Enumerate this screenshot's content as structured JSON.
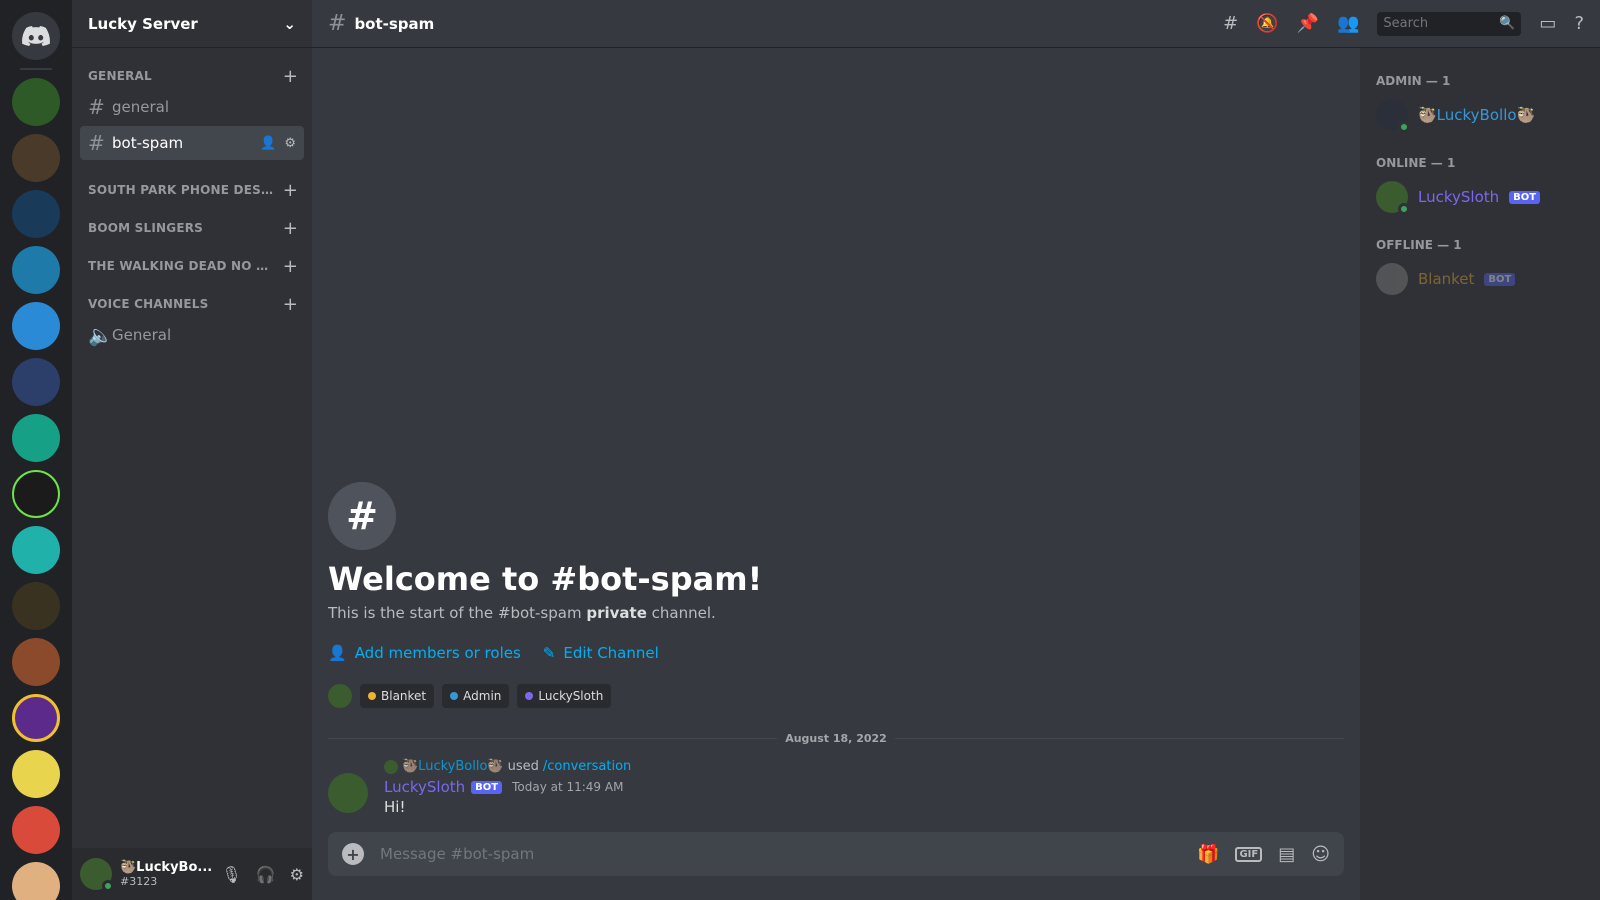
{
  "server": {
    "name": "Lucky Server"
  },
  "channel": {
    "name": "bot-spam",
    "search_placeholder": "Search"
  },
  "categories": [
    {
      "label": "GENERAL"
    },
    {
      "label": "SOUTH PARK PHONE DESTRO..."
    },
    {
      "label": "BOOM SLINGERS"
    },
    {
      "label": "THE WALKING DEAD NO MAN..."
    },
    {
      "label": "VOICE CHANNELS"
    }
  ],
  "channels": {
    "general": "general",
    "bot_spam": "bot-spam",
    "voice_general": "General"
  },
  "user": {
    "name": "🦥LuckyBo...",
    "tag": "#3123"
  },
  "welcome": {
    "title": "Welcome to #bot-spam!",
    "sub_pre": "This is the start of the #bot-spam",
    "sub_bold": "private",
    "sub_post": "channel.",
    "add_members": "Add members or roles",
    "edit_channel": "Edit Channel"
  },
  "roles": [
    {
      "name": "Blanket",
      "color": "#f0b232"
    },
    {
      "name": "Admin",
      "color": "#3498db"
    },
    {
      "name": "LuckySloth",
      "color": "#7b68ee"
    }
  ],
  "date_divider": "August 18, 2022",
  "message": {
    "reply_user": "🦥LuckyBollo🦥",
    "reply_used": "used",
    "reply_command": "/conversation",
    "author": "LuckySloth",
    "bot_tag": "BOT",
    "time": "Today at 11:49 AM",
    "body": "Hi!"
  },
  "composer": {
    "placeholder": "Message #bot-spam"
  },
  "members": {
    "admin_header": "ADMIN — 1",
    "admin_name": "🦥LuckyBollo🦥",
    "online_header": "ONLINE — 1",
    "online_name": "LuckySloth",
    "offline_header": "OFFLINE — 1",
    "offline_name": "Blanket",
    "bot_tag": "BOT"
  },
  "colors": {
    "accent": "#5865f2",
    "link": "#00aff4",
    "online": "#3ba55d"
  }
}
